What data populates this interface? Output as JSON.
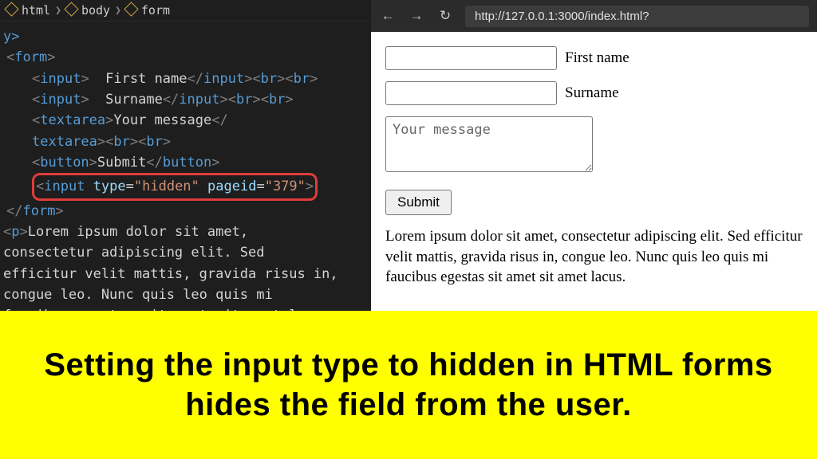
{
  "breadcrumb": {
    "items": [
      "html",
      "body",
      "form"
    ]
  },
  "code": {
    "line1": "y>",
    "form_open": "form",
    "input_tag": "input",
    "first_name_text": "  First name",
    "surname_text": "  Surname",
    "br_tag": "br",
    "textarea_tag": "textarea",
    "textarea_text": "Your message",
    "button_tag": "button",
    "button_text": "Submit",
    "hidden_attr_type": "type",
    "hidden_attr_type_val": "\"hidden\"",
    "hidden_attr_pageid": "pageid",
    "hidden_attr_pageid_val": "\"379\"",
    "form_close": "form",
    "p_tag": "p",
    "p_text1": "Lorem ipsum dolor sit amet,",
    "p_text2": "consectetur adipiscing elit. Sed",
    "p_text3": "efficitur velit mattis, gravida risus in,",
    "p_text4": "congue leo. Nunc quis leo quis mi",
    "p_text5": "faucibus egestas sit amet sit amet lacus."
  },
  "browser": {
    "url": "http://127.0.0.1:3000/index.html?"
  },
  "page": {
    "first_name_label": "First name",
    "surname_label": "Surname",
    "message_placeholder": "Your message",
    "submit_label": "Submit",
    "lorem": "Lorem ipsum dolor sit amet, consectetur adipiscing elit. Sed efficitur velit mattis, gravida risus in, congue leo. Nunc quis leo quis mi faucibus egestas sit amet sit amet lacus."
  },
  "banner": {
    "text": "Setting the input type to hidden in HTML forms hides the field from the user."
  }
}
